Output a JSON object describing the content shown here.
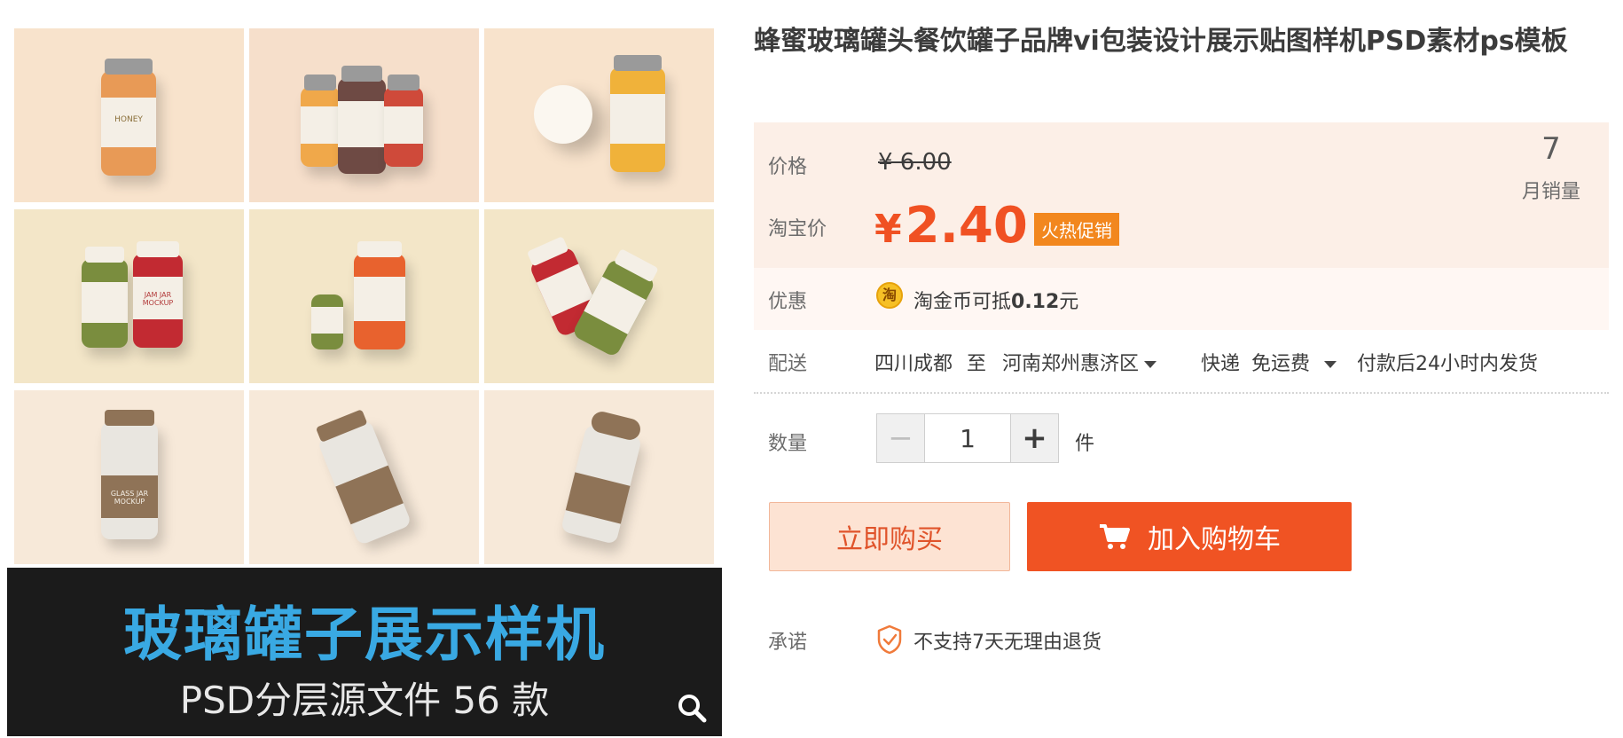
{
  "product": {
    "title": "蜂蜜玻璃罐头餐饮罐子品牌vi包装设计展示贴图样机PSD素材ps模板"
  },
  "gallery": {
    "caption_main": "玻璃罐子展示样机",
    "caption_sub": "PSD分层源文件 56 款",
    "jar_labels": [
      "HONEY",
      "JAM JAR MOCKUP",
      "GLASS JAR MOCKUP"
    ]
  },
  "price": {
    "label": "价格",
    "original": "¥ 6.00",
    "taobao_label": "淘宝价",
    "currency": "¥",
    "current": "2.40",
    "badge": "火热促销",
    "sales_count": "7",
    "sales_label": "月销量"
  },
  "promo": {
    "label": "优惠",
    "coin_glyph": "淘",
    "text_prefix": "淘金币可抵",
    "amount": "0.12",
    "text_suffix": "元"
  },
  "shipping": {
    "label": "配送",
    "from": "四川成都",
    "to_word": "至",
    "destination": "河南郑州惠济区",
    "method": "快递",
    "fee": "免运费",
    "dispatch": "付款后24小时内发货"
  },
  "quantity": {
    "label": "数量",
    "value": "1",
    "unit": "件"
  },
  "actions": {
    "buy_now": "立即购买",
    "add_to_cart": "加入购物车"
  },
  "promise": {
    "label": "承诺",
    "text": "不支持7天无理由退货"
  },
  "colors": {
    "accent": "#f05323",
    "price": "#f05123",
    "badge": "#f2871e",
    "caption_blue": "#39a9e3"
  }
}
